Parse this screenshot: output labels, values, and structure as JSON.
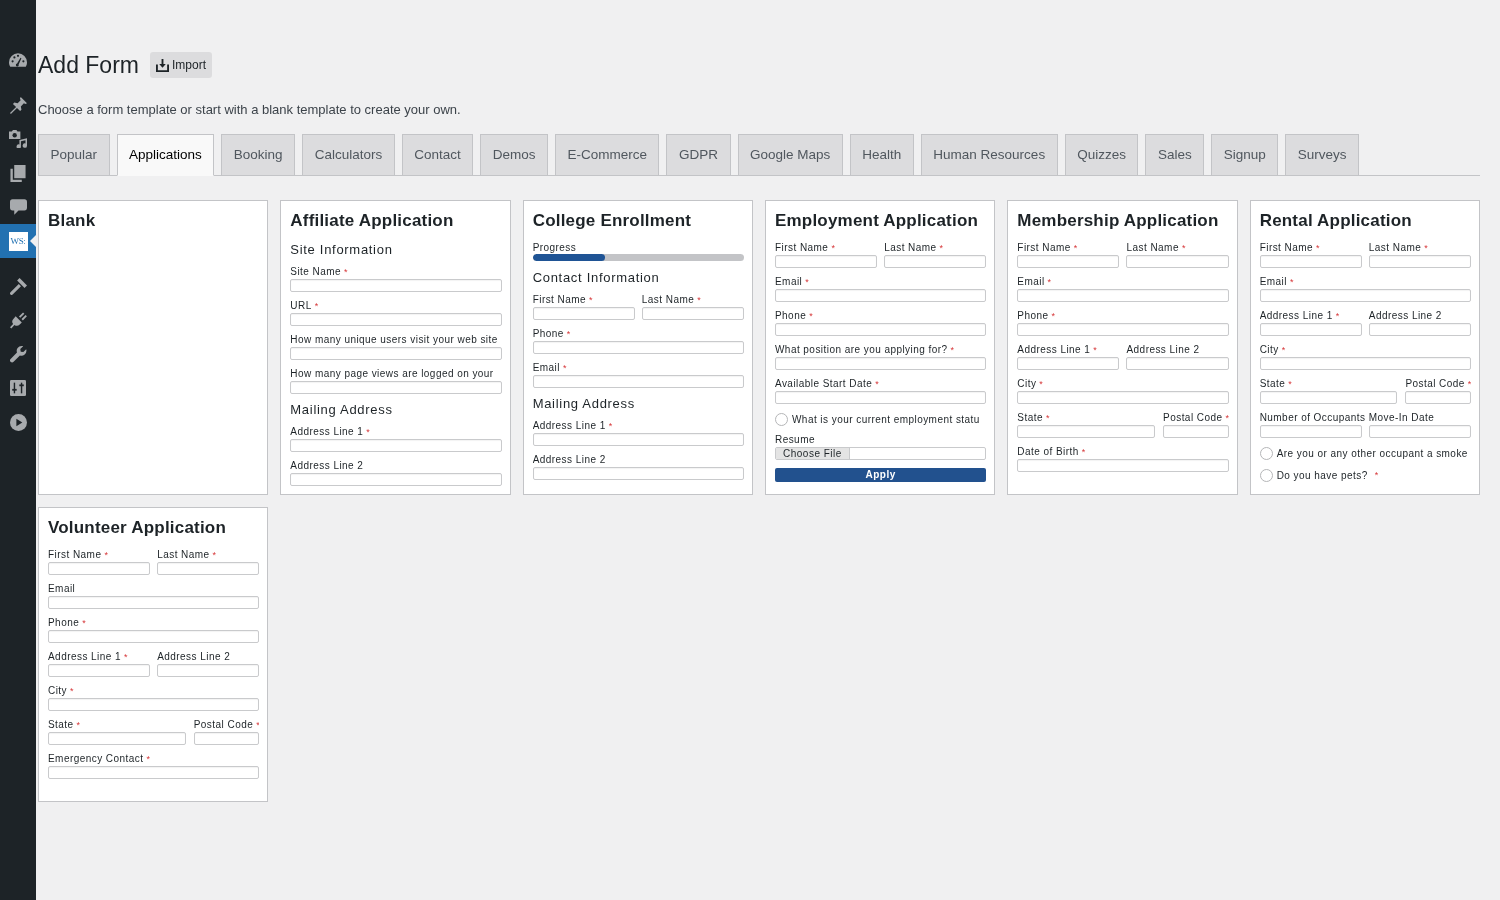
{
  "sidebar": {
    "groups": [
      {
        "items": [
          {
            "selected": false
          }
        ]
      },
      {
        "items": [
          {
            "selected": false
          },
          {
            "selected": false
          },
          {
            "selected": false
          },
          {
            "selected": false
          },
          {
            "selected": true,
            "logo_text": "WS:"
          }
        ]
      },
      {
        "items": [
          {
            "selected": false
          },
          {
            "selected": false
          },
          {
            "selected": false
          },
          {
            "selected": false
          },
          {
            "selected": false
          }
        ]
      }
    ]
  },
  "header": {
    "title": "Add Form",
    "import_button": "Import",
    "description": "Choose a form template or start with a blank template to create your own."
  },
  "tabs": [
    {
      "label": "Popular",
      "selected": false
    },
    {
      "label": "Applications",
      "selected": true
    },
    {
      "label": "Booking",
      "selected": false
    },
    {
      "label": "Calculators",
      "selected": false
    },
    {
      "label": "Contact",
      "selected": false
    },
    {
      "label": "Demos",
      "selected": false
    },
    {
      "label": "E-Commerce",
      "selected": false
    },
    {
      "label": "GDPR",
      "selected": false
    },
    {
      "label": "Google Maps",
      "selected": false
    },
    {
      "label": "Health",
      "selected": false
    },
    {
      "label": "Human Resources",
      "selected": false
    },
    {
      "label": "Quizzes",
      "selected": false
    },
    {
      "label": "Sales",
      "selected": false
    },
    {
      "label": "Signup",
      "selected": false
    },
    {
      "label": "Surveys",
      "selected": false
    }
  ],
  "templates": [
    {
      "title": "Blank"
    },
    {
      "title": "Affiliate Application",
      "items": [
        {
          "kind": "heading",
          "text": "Site Information"
        },
        {
          "kind": "input",
          "label": "Site Name",
          "required_mark": "*"
        },
        {
          "kind": "input",
          "label": "URL",
          "required_mark": "*"
        },
        {
          "kind": "input",
          "label": "How many unique users visit your web site"
        },
        {
          "kind": "input",
          "label": "How many page views are logged on your"
        },
        {
          "kind": "heading",
          "text": "Mailing Address"
        },
        {
          "kind": "input",
          "label": "Address Line 1",
          "required_mark": "*"
        },
        {
          "kind": "input",
          "label": "Address Line 2"
        }
      ]
    },
    {
      "title": "College Enrollment",
      "items": [
        {
          "kind": "progress",
          "label": "Progress",
          "level": 0.34
        },
        {
          "kind": "heading",
          "text": "Contact Information"
        },
        {
          "kind": "pair",
          "fields": [
            {
              "label": "First Name",
              "required_mark": "*"
            },
            {
              "label": "Last Name",
              "required_mark": "*"
            }
          ]
        },
        {
          "kind": "input",
          "label": "Phone",
          "required_mark": "*"
        },
        {
          "kind": "input",
          "label": "Email",
          "required_mark": "*"
        },
        {
          "kind": "heading",
          "text": "Mailing Address"
        },
        {
          "kind": "input",
          "label": "Address Line 1",
          "required_mark": "*"
        },
        {
          "kind": "input",
          "label": "Address Line 2"
        }
      ]
    },
    {
      "title": "Employment Application",
      "items": [
        {
          "kind": "pair",
          "fields": [
            {
              "label": "First Name",
              "required_mark": "*"
            },
            {
              "label": "Last Name",
              "required_mark": "*"
            }
          ]
        },
        {
          "kind": "input",
          "label": "Email",
          "required_mark": "*"
        },
        {
          "kind": "input",
          "label": "Phone",
          "required_mark": "*"
        },
        {
          "kind": "input",
          "label": "What position are you applying for?",
          "required_mark": "*"
        },
        {
          "kind": "input",
          "label": "Available Start Date",
          "required_mark": "*"
        },
        {
          "kind": "radio",
          "label": "What is your current employment statu",
          "checked": false
        },
        {
          "kind": "file",
          "label": "Resume",
          "button": "Choose File"
        },
        {
          "kind": "submit",
          "text": "Apply"
        }
      ]
    },
    {
      "title": "Membership Application",
      "items": [
        {
          "kind": "pair",
          "fields": [
            {
              "label": "First Name",
              "required_mark": "*"
            },
            {
              "label": "Last Name",
              "required_mark": "*"
            }
          ]
        },
        {
          "kind": "input",
          "label": "Email",
          "required_mark": "*"
        },
        {
          "kind": "input",
          "label": "Phone",
          "required_mark": "*"
        },
        {
          "kind": "pair",
          "fields": [
            {
              "label": "Address Line 1",
              "required_mark": "*"
            },
            {
              "label": "Address Line 2"
            }
          ]
        },
        {
          "kind": "input",
          "label": "City",
          "required_mark": "*"
        },
        {
          "kind": "pair-narrow-end",
          "fields": [
            {
              "label": "State",
              "required_mark": "*"
            },
            {
              "label": "Postal Code",
              "required_mark": "*"
            }
          ]
        },
        {
          "kind": "input",
          "label": "Date of Birth",
          "required_mark": "*"
        }
      ]
    },
    {
      "title": "Rental Application",
      "items": [
        {
          "kind": "pair",
          "fields": [
            {
              "label": "First Name",
              "required_mark": "*"
            },
            {
              "label": "Last Name",
              "required_mark": "*"
            }
          ]
        },
        {
          "kind": "input",
          "label": "Email",
          "required_mark": "*"
        },
        {
          "kind": "pair",
          "fields": [
            {
              "label": "Address Line 1",
              "required_mark": "*"
            },
            {
              "label": "Address Line 2"
            }
          ]
        },
        {
          "kind": "input",
          "label": "City",
          "required_mark": "*"
        },
        {
          "kind": "pair-narrow-end",
          "fields": [
            {
              "label": "State",
              "required_mark": "*"
            },
            {
              "label": "Postal Code",
              "required_mark": "*"
            }
          ]
        },
        {
          "kind": "pair",
          "fields": [
            {
              "label": "Number of Occupants"
            },
            {
              "label": "Move-In Date"
            }
          ]
        },
        {
          "kind": "radio",
          "label": "Are you or any other occupant a smoke",
          "checked": false
        },
        {
          "kind": "radio",
          "label": "Do you have pets?",
          "required_mark": "*",
          "checked": false
        }
      ]
    },
    {
      "title": "Volunteer Application",
      "items": [
        {
          "kind": "pair",
          "fields": [
            {
              "label": "First Name",
              "required_mark": "*"
            },
            {
              "label": "Last Name",
              "required_mark": "*"
            }
          ]
        },
        {
          "kind": "input",
          "label": "Email"
        },
        {
          "kind": "input",
          "label": "Phone",
          "required_mark": "*"
        },
        {
          "kind": "pair",
          "fields": [
            {
              "label": "Address Line 1",
              "required_mark": "*"
            },
            {
              "label": "Address Line 2"
            }
          ]
        },
        {
          "kind": "input",
          "label": "City",
          "required_mark": "*"
        },
        {
          "kind": "pair-narrow-end",
          "fields": [
            {
              "label": "State",
              "required_mark": "*"
            },
            {
              "label": "Postal Code",
              "required_mark": "*"
            }
          ]
        },
        {
          "kind": "input",
          "label": "Emergency Contact",
          "required_mark": "*"
        }
      ]
    }
  ]
}
